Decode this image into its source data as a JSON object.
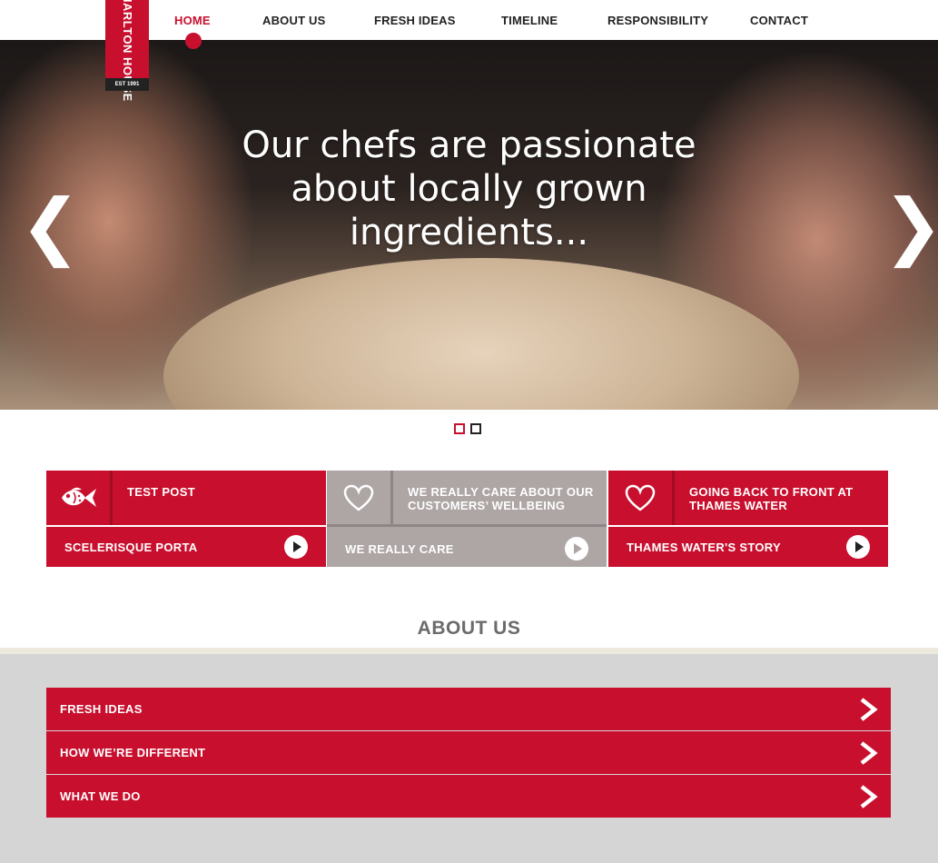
{
  "logo": {
    "name": "CHARLTON HOUSE",
    "established": "EST 1991"
  },
  "nav": {
    "items": [
      {
        "label": "HOME",
        "active": true
      },
      {
        "label": "ABOUT US",
        "active": false
      },
      {
        "label": "FRESH IDEAS",
        "active": false
      },
      {
        "label": "TIMELINE",
        "active": false
      },
      {
        "label": "RESPONSIBILITY",
        "active": false
      },
      {
        "label": "CONTACT",
        "active": false
      }
    ]
  },
  "hero": {
    "headline": "Our chefs are passionate about locally grown ingredients...",
    "prev_glyph": "❮",
    "next_glyph": "❯",
    "slide_count": 2,
    "active_slide": 1
  },
  "cards": [
    {
      "icon": "fish-icon",
      "title": "TEST POST",
      "link": "SCELERISQUE PORTA",
      "theme": "red"
    },
    {
      "icon": "heart-icon",
      "title": "WE REALLY CARE ABOUT OUR CUSTOMERS’ WELLBEING",
      "link": "WE REALLY CARE",
      "theme": "grey"
    },
    {
      "icon": "heart-icon",
      "title": "GOING BACK TO FRONT AT THAMES WATER",
      "link": "THAMES WATER'S STORY",
      "theme": "red"
    }
  ],
  "about": {
    "title": "ABOUT US",
    "items": [
      {
        "label": "FRESH IDEAS"
      },
      {
        "label": "HOW WE’RE DIFFERENT"
      },
      {
        "label": "WHAT WE DO"
      }
    ]
  },
  "colors": {
    "brand_red": "#c8102e",
    "card_grey": "#aea5a5",
    "band_grey": "#d5d5d5",
    "text_dark": "#222222"
  }
}
